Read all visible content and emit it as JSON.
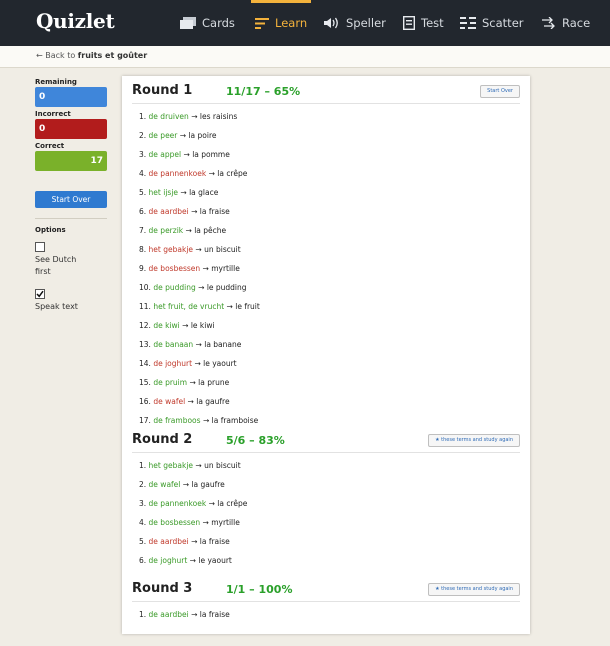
{
  "app": {
    "logo": "Quizlet"
  },
  "nav": [
    {
      "label": "Cards",
      "icon": "cards-icon"
    },
    {
      "label": "Learn",
      "icon": "learn-icon",
      "active": true
    },
    {
      "label": "Speller",
      "icon": "speller-icon"
    },
    {
      "label": "Test",
      "icon": "test-icon"
    },
    {
      "label": "Scatter",
      "icon": "scatter-icon"
    },
    {
      "label": "Race",
      "icon": "race-icon"
    }
  ],
  "breadcrumb": {
    "prefix": "← Back to",
    "set_name": "fruits et goûter"
  },
  "sidebar": {
    "remaining_label": "Remaining",
    "remaining_value": "0",
    "incorrect_label": "Incorrect",
    "incorrect_value": "0",
    "correct_label": "Correct",
    "correct_value": "17",
    "start_over_label": "Start Over",
    "options_label": "Options",
    "see_dutch_first_label": "See Dutch first",
    "see_dutch_first_checked": false,
    "speak_text_label": "Speak text",
    "speak_text_checked": true
  },
  "colors": {
    "correct": "#3a9a28",
    "incorrect": "#c0392b",
    "accent": "#f3b23c",
    "primary": "#2f7ad0"
  },
  "rounds": [
    {
      "title": "Round 1",
      "score": "11/17 – 65%",
      "button": "Start Over",
      "items": [
        {
          "n": "1.",
          "term": "de druiven",
          "def": "les raisins",
          "correct": true
        },
        {
          "n": "2.",
          "term": "de peer",
          "def": "la poire",
          "correct": true
        },
        {
          "n": "3.",
          "term": "de appel",
          "def": "la pomme",
          "correct": true
        },
        {
          "n": "4.",
          "term": "de pannenkoek",
          "def": "la crêpe",
          "correct": false
        },
        {
          "n": "5.",
          "term": "het ijsje",
          "def": "la glace",
          "correct": true
        },
        {
          "n": "6.",
          "term": "de aardbei",
          "def": "la fraise",
          "correct": false
        },
        {
          "n": "7.",
          "term": "de perzik",
          "def": "la pêche",
          "correct": true
        },
        {
          "n": "8.",
          "term": "het gebakje",
          "def": "un biscuit",
          "correct": false
        },
        {
          "n": "9.",
          "term": "de bosbessen",
          "def": "myrtille",
          "correct": false
        },
        {
          "n": "10.",
          "term": "de pudding",
          "def": "le pudding",
          "correct": true
        },
        {
          "n": "11.",
          "term": "het fruit, de vrucht",
          "def": "le fruit",
          "correct": true
        },
        {
          "n": "12.",
          "term": "de kiwi",
          "def": "le kiwi",
          "correct": true
        },
        {
          "n": "13.",
          "term": "de banaan",
          "def": "la banane",
          "correct": true
        },
        {
          "n": "14.",
          "term": "de joghurt",
          "def": "le yaourt",
          "correct": false
        },
        {
          "n": "15.",
          "term": "de pruim",
          "def": "la prune",
          "correct": true
        },
        {
          "n": "16.",
          "term": "de wafel",
          "def": "la gaufre",
          "correct": false
        },
        {
          "n": "17.",
          "term": "de framboos",
          "def": "la framboise",
          "correct": true
        }
      ]
    },
    {
      "title": "Round 2",
      "score": "5/6 – 83%",
      "button": "★ these terms and study again",
      "items": [
        {
          "n": "1.",
          "term": "het gebakje",
          "def": "un biscuit",
          "correct": true
        },
        {
          "n": "2.",
          "term": "de wafel",
          "def": "la gaufre",
          "correct": true
        },
        {
          "n": "3.",
          "term": "de pannenkoek",
          "def": "la crêpe",
          "correct": true
        },
        {
          "n": "4.",
          "term": "de bosbessen",
          "def": "myrtille",
          "correct": true
        },
        {
          "n": "5.",
          "term": "de aardbei",
          "def": "la fraise",
          "correct": false
        },
        {
          "n": "6.",
          "term": "de joghurt",
          "def": "le yaourt",
          "correct": true
        }
      ]
    },
    {
      "title": "Round 3",
      "score": "1/1 – 100%",
      "button": "★ these terms and study again",
      "items": [
        {
          "n": "1.",
          "term": "de aardbei",
          "def": "la fraise",
          "correct": true
        }
      ]
    }
  ]
}
